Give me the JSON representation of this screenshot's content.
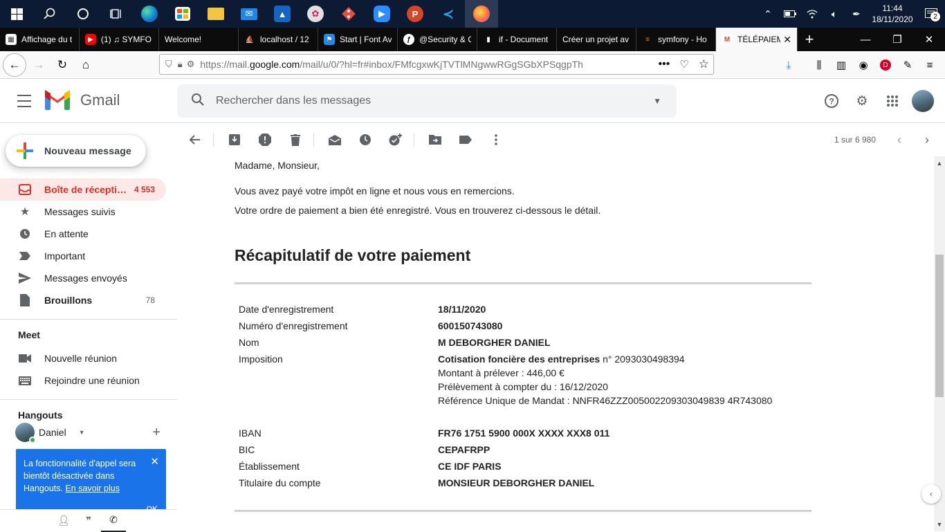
{
  "taskbar": {
    "clock_time": "11:44",
    "clock_date": "18/11/2020",
    "notifications": "2"
  },
  "browser": {
    "tabs": [
      {
        "title": "Affichage du t",
        "favicon": "table-icon"
      },
      {
        "title": "(1) ♫ SYMFO",
        "favicon": "youtube-icon"
      },
      {
        "title": "Welcome!",
        "favicon": "none"
      },
      {
        "title": "localhost / 12",
        "favicon": "phpmyadmin-icon"
      },
      {
        "title": "Start | Font Av",
        "favicon": "flag-icon"
      },
      {
        "title": "@Security & C",
        "favicon": "symfony-icon"
      },
      {
        "title": "if - Document",
        "favicon": "doc-icon"
      },
      {
        "title": "Créer un projet av",
        "favicon": "none"
      },
      {
        "title": "symfony - Ho",
        "favicon": "stackoverflow-icon"
      },
      {
        "title": "TÉLÉPAIEM",
        "favicon": "gmail-icon",
        "active": true
      }
    ],
    "url_prefix": "https://mail.",
    "url_domain": "google.com",
    "url_rest": "/mail/u/0/?hl=fr#inbox/FMfcgxwKjTVTlMNgwwRGgSGbXPSqgpTh",
    "profile_badge": "D"
  },
  "gmail": {
    "logo_text": "Gmail",
    "search_placeholder": "Rechercher dans les messages",
    "compose_label": "Nouveau message",
    "nav": [
      {
        "label": "Boîte de récepti…",
        "count": "4 553",
        "icon": "inbox-icon",
        "active": true
      },
      {
        "label": "Messages suivis",
        "count": "",
        "icon": "star-icon"
      },
      {
        "label": "En attente",
        "count": "",
        "icon": "clock-icon"
      },
      {
        "label": "Important",
        "count": "",
        "icon": "important-icon"
      },
      {
        "label": "Messages envoyés",
        "count": "",
        "icon": "send-icon"
      },
      {
        "label": "Brouillons",
        "count": "78",
        "icon": "draft-icon",
        "bold": true
      }
    ],
    "meet": {
      "title": "Meet",
      "items": [
        {
          "label": "Nouvelle réunion",
          "icon": "video-icon"
        },
        {
          "label": "Rejoindre une réunion",
          "icon": "keyboard-icon"
        }
      ]
    },
    "hangouts": {
      "title": "Hangouts",
      "user": "Daniel",
      "toast_text": "La fonctionnalité d'appel sera bientôt désactivée dans Hangouts.",
      "toast_link": "En savoir plus",
      "toast_ok": "OK"
    },
    "pager_text": "1 sur 6 980"
  },
  "email": {
    "greeting": "Madame, Monsieur,",
    "line1": "Vous avez payé votre impôt en ligne et nous vous en remercions.",
    "line2": "Votre ordre de paiement a bien été enregistré. Vous en trouverez ci-dessous le détail.",
    "recap_title": "Récapitulatif de votre paiement",
    "rows": {
      "date_label": "Date d'enregistrement",
      "date_value": "18/11/2020",
      "numero_label": "Numéro d'enregistrement",
      "numero_value": "600150743080",
      "nom_label": "Nom",
      "nom_value": "M DEBORGHER DANIEL",
      "imposition_label": "Imposition",
      "imposition_value_bold": "Cotisation foncière des entreprises",
      "imposition_value_rest": " n° 2093030498394",
      "montant": "Montant à prélever : 446,00 €",
      "prelevement": "Prélèvement à compter du : 16/12/2020",
      "reference": "Référence Unique de Mandat : NNFR46ZZZ005002209303049839 4R743080",
      "iban_label": "IBAN",
      "iban_value": "FR76 1751 5900 000X XXXX XXX8 011",
      "bic_label": "BIC",
      "bic_value": "CEPAFRPP",
      "etab_label": "Établissement",
      "etab_value": "CE IDF PARIS",
      "titulaire_label": "Titulaire du compte",
      "titulaire_value": "MONSIEUR DEBORGHER DANIEL"
    }
  },
  "colors": {
    "taskbar": "#0d1a33",
    "gmail_red": "#d93025",
    "toast_blue": "#1a73e8"
  }
}
